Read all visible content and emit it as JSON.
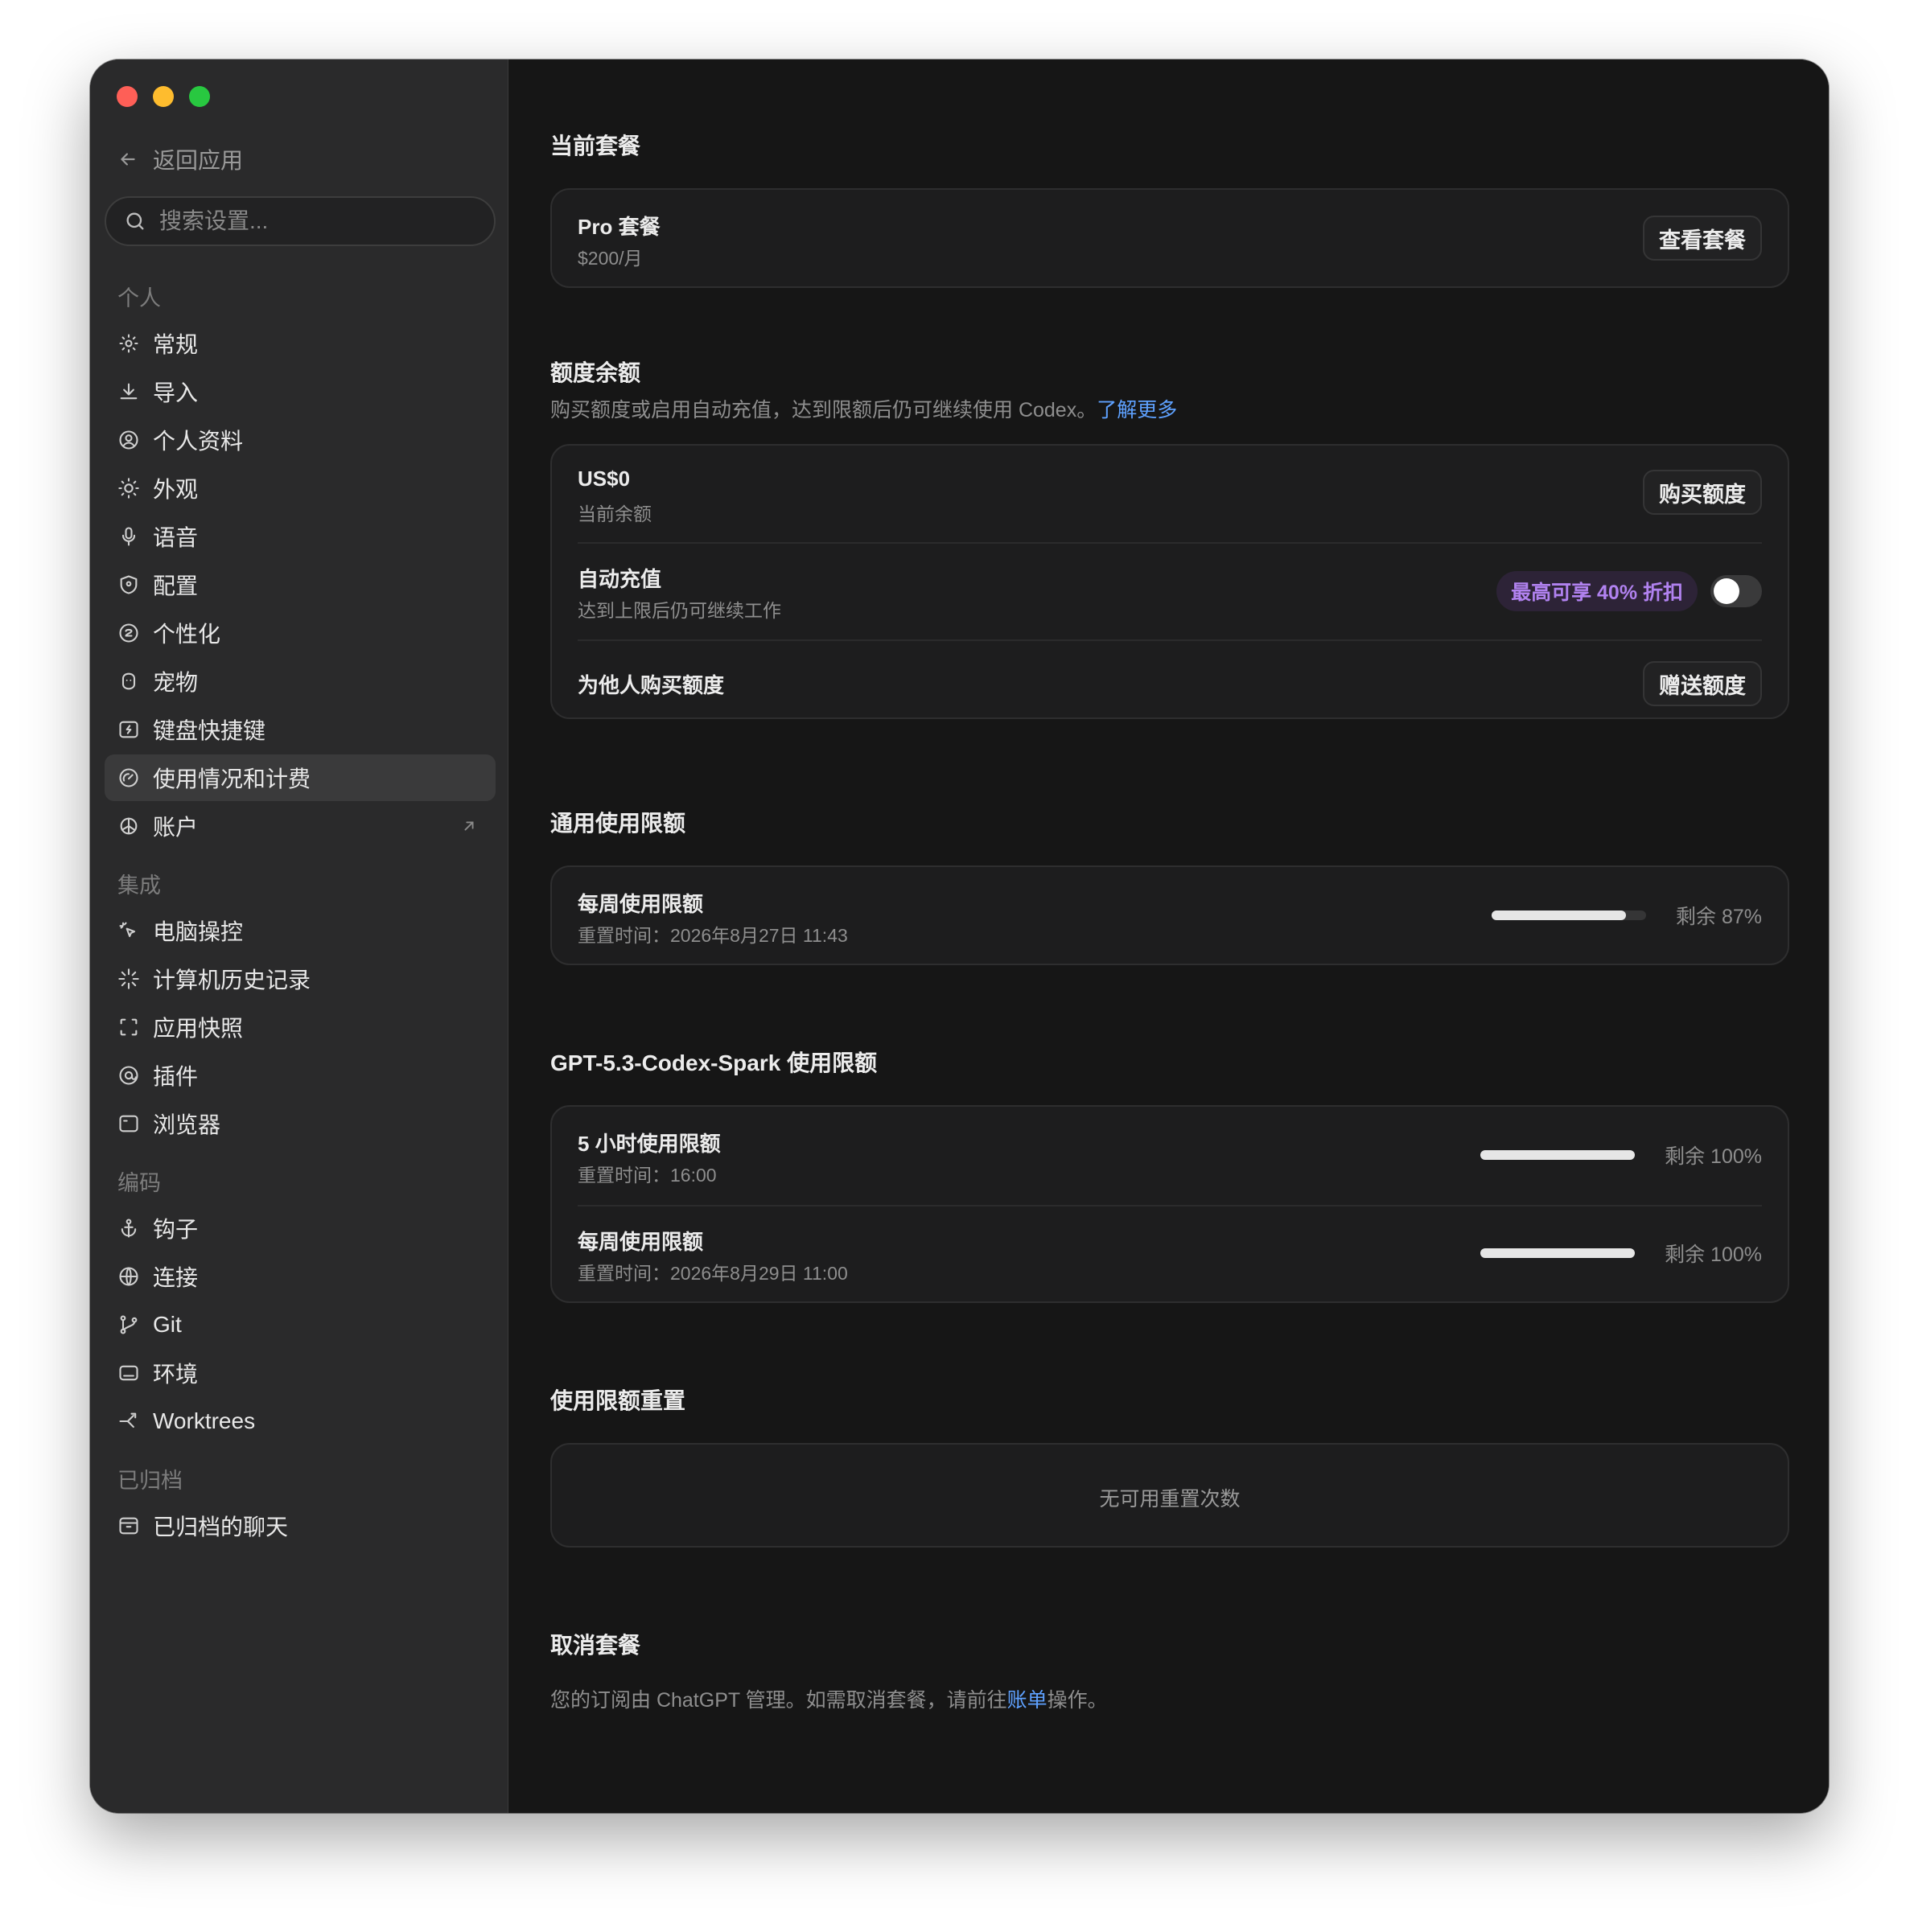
{
  "window": {
    "controls": [
      "close",
      "minimize",
      "zoom"
    ]
  },
  "sidebar": {
    "back_label": "返回应用",
    "search_placeholder": "搜索设置...",
    "sections": [
      {
        "title": "个人",
        "items": [
          {
            "label": "常规",
            "icon": "gear-icon"
          },
          {
            "label": "导入",
            "icon": "download-icon"
          },
          {
            "label": "个人资料",
            "icon": "user-circle-icon"
          },
          {
            "label": "外观",
            "icon": "sun-icon"
          },
          {
            "label": "语音",
            "icon": "microphone-icon"
          },
          {
            "label": "配置",
            "icon": "shield-icon"
          },
          {
            "label": "个性化",
            "icon": "personalize-icon"
          },
          {
            "label": "宠物",
            "icon": "pet-icon"
          },
          {
            "label": "键盘快捷键",
            "icon": "keyboard-icon"
          },
          {
            "label": "使用情况和计费",
            "icon": "gauge-icon",
            "active": true
          },
          {
            "label": "账户",
            "icon": "openai-icon",
            "external": true
          }
        ]
      },
      {
        "title": "集成",
        "items": [
          {
            "label": "电脑操控",
            "icon": "pointer-icon"
          },
          {
            "label": "计算机历史记录",
            "icon": "sparkle-icon"
          },
          {
            "label": "应用快照",
            "icon": "snapshot-icon"
          },
          {
            "label": "插件",
            "icon": "plugin-icon"
          },
          {
            "label": "浏览器",
            "icon": "browser-icon"
          }
        ]
      },
      {
        "title": "编码",
        "items": [
          {
            "label": "钩子",
            "icon": "anchor-icon"
          },
          {
            "label": "连接",
            "icon": "globe-icon"
          },
          {
            "label": "Git",
            "icon": "git-branch-icon"
          },
          {
            "label": "环境",
            "icon": "environment-icon"
          },
          {
            "label": "Worktrees",
            "icon": "worktree-icon"
          }
        ]
      },
      {
        "title": "已归档",
        "items": [
          {
            "label": "已归档的聊天",
            "icon": "archive-icon"
          }
        ]
      }
    ]
  },
  "main": {
    "plan": {
      "section_title": "当前套餐",
      "name": "Pro 套餐",
      "price": "$200/月",
      "button": "查看套餐"
    },
    "credits": {
      "section_title": "额度余额",
      "description": "购买额度或启用自动充值，达到限额后仍可继续使用 Codex。",
      "learn_more": "了解更多",
      "balance_value": "US$0",
      "balance_label": "当前余额",
      "buy_button": "购买额度",
      "auto_recharge_title": "自动充值",
      "auto_recharge_sub": "达到上限后仍可继续工作",
      "promo_badge": "最高可享 40% 折扣",
      "auto_recharge_enabled": false,
      "gift_title": "为他人购买额度",
      "gift_button": "赠送额度"
    },
    "general_limits": {
      "section_title": "通用使用限额",
      "items": [
        {
          "title": "每周使用限额",
          "reset": "重置时间：2026年8月27日 11:43",
          "remaining_pct": 87,
          "remaining_label": "剩余 87%"
        }
      ]
    },
    "spark_limits": {
      "section_title": "GPT-5.3-Codex-Spark 使用限额",
      "items": [
        {
          "title": "5 小时使用限额",
          "reset": "重置时间：16:00",
          "remaining_pct": 100,
          "remaining_label": "剩余 100%"
        },
        {
          "title": "每周使用限额",
          "reset": "重置时间：2026年8月29日 11:00",
          "remaining_pct": 100,
          "remaining_label": "剩余 100%"
        }
      ]
    },
    "reset": {
      "section_title": "使用限额重置",
      "empty_text": "无可用重置次数"
    },
    "cancel": {
      "section_title": "取消套餐",
      "text_before": "您的订阅由 ChatGPT 管理。如需取消套餐，请前往",
      "link": "账单",
      "text_after": "操作。"
    }
  },
  "colors": {
    "sidebar_bg": "#2a2a2b",
    "main_bg": "#161616",
    "card_bg": "#1d1d1e",
    "link": "#5ea1ff",
    "promo_text": "#b182f0",
    "promo_bg": "#2d2337"
  }
}
